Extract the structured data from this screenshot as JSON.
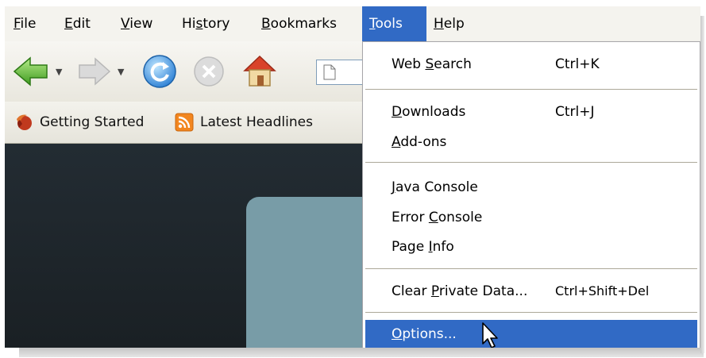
{
  "menubar": {
    "items": [
      {
        "pre": "",
        "u": "F",
        "post": "ile"
      },
      {
        "pre": "",
        "u": "E",
        "post": "dit"
      },
      {
        "pre": "",
        "u": "V",
        "post": "iew"
      },
      {
        "pre": "Hi",
        "u": "s",
        "post": "tory"
      },
      {
        "pre": "",
        "u": "B",
        "post": "ookmarks"
      },
      {
        "pre": "",
        "u": "T",
        "post": "ools"
      },
      {
        "pre": "",
        "u": "H",
        "post": "elp"
      }
    ]
  },
  "bookmarks": {
    "items": [
      {
        "label": "Getting Started",
        "icon": "firefox-icon"
      },
      {
        "label": "Latest Headlines",
        "icon": "rss-feed-icon"
      }
    ]
  },
  "tools_menu": {
    "web_search": {
      "pre": "Web ",
      "u": "S",
      "post": "earch",
      "shortcut": "Ctrl+K"
    },
    "downloads": {
      "pre": "",
      "u": "D",
      "post": "ownloads",
      "shortcut": "Ctrl+J"
    },
    "addons": {
      "pre": "",
      "u": "A",
      "post": "dd-ons"
    },
    "java_console": {
      "pre": "",
      "u": "J",
      "post": "ava Console"
    },
    "error_console": {
      "pre": "Error ",
      "u": "C",
      "post": "onsole"
    },
    "page_info": {
      "pre": "Page ",
      "u": "I",
      "post": "nfo"
    },
    "clear_private": {
      "pre": "Clear ",
      "u": "P",
      "post": "rivate Data...",
      "shortcut": "Ctrl+Shift+Del"
    },
    "options": {
      "pre": "",
      "u": "O",
      "post": "ptions..."
    }
  },
  "colors": {
    "menu_highlight": "#316ac5",
    "menu_background": "#ffffff",
    "separator": "#aca899"
  }
}
